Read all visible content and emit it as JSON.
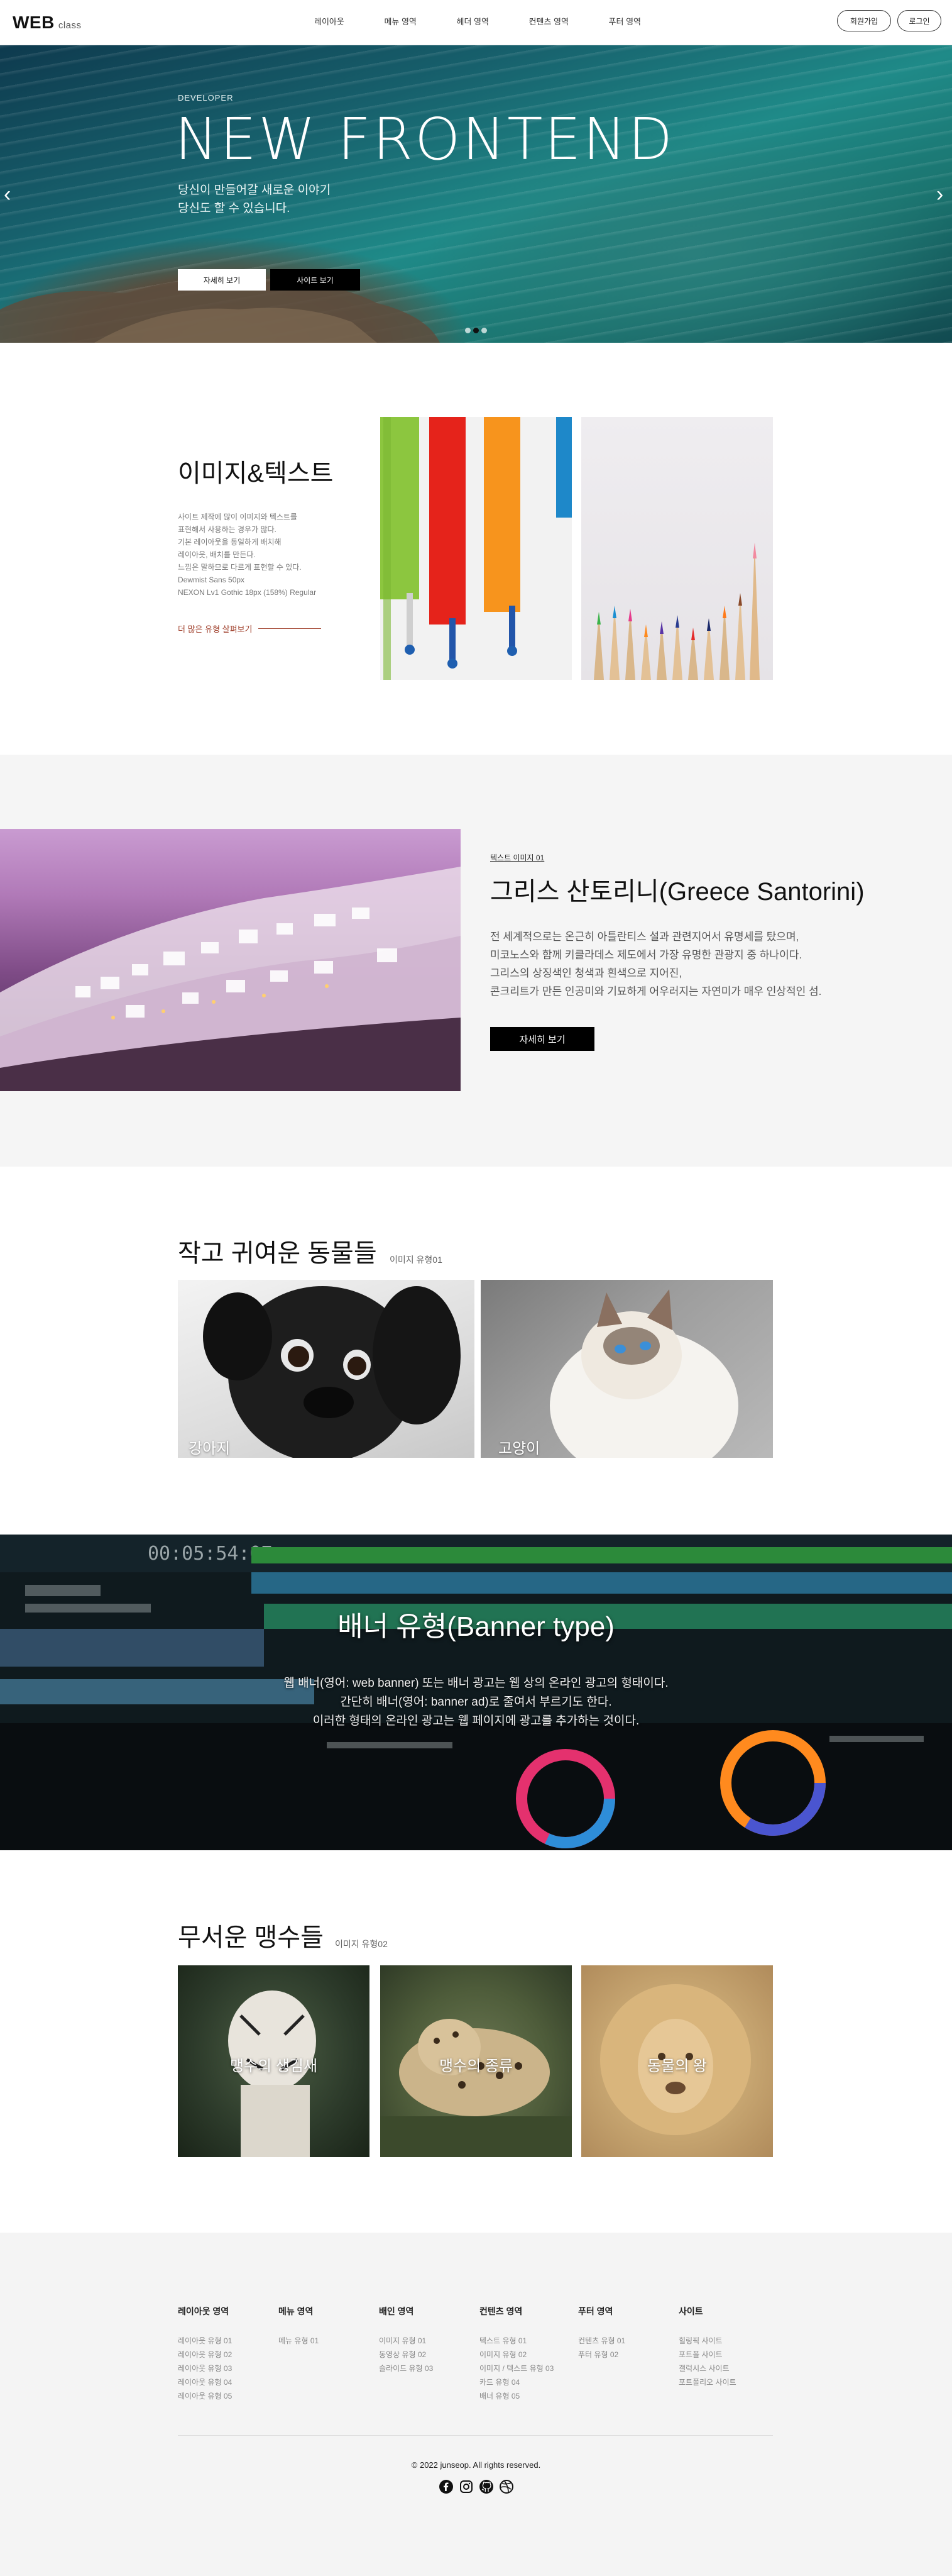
{
  "header": {
    "logo": "WEB",
    "logo_sub": "class",
    "nav": [
      "레이아웃",
      "메뉴 영역",
      "헤더 영역",
      "컨텐츠 영역",
      "푸터 영역"
    ],
    "join_label": "회원가입",
    "login_label": "로그인"
  },
  "hero": {
    "eyebrow": "DEVELOPER",
    "title": "NEW FRONTEND",
    "desc_line1": "당신이 만들어갈 새로운 이야기",
    "desc_line2": "당신도 할 수 있습니다.",
    "btn_more": "자세히 보기",
    "btn_site": "사이트 보기",
    "prev": "‹",
    "next": "›"
  },
  "image_text": {
    "title": "이미지&텍스트",
    "desc": [
      "사이트 제작에 많이 이미지와 텍스트를",
      "표현해서 사용하는 경우가 많다.",
      "기본 레이아웃을 동일하게 배치해",
      "레이아웃, 배치를 만든다.",
      "느낌은 말하므로 다르게 표현할 수 있다.",
      "Dewmist Sans 50px",
      "NEXON Lv1 Gothic 18px (158%) Regular"
    ],
    "more_label": "더 많은 유형 살펴보기"
  },
  "santorini": {
    "eyebrow": "텍스트 이미지 01",
    "title": "그리스 산토리니(Greece Santorini)",
    "desc": [
      "전 세계적으로는 온근히 아틀란티스 설과 관련지어서 유명세를 탔으며,",
      "미코노스와 함께 키클라데스 제도에서 가장 유명한 관광지 중 하나이다.",
      "그리스의 상징색인 청색과 흰색으로 지어진,",
      "콘크리트가 만든 인공미와 기묘하게 어우러지는 자연미가 매우 인상적인 섬."
    ],
    "btn_label": "자세히 보기"
  },
  "animals": {
    "title": "작고 귀여운 동물들",
    "sub": "이미지 유형01",
    "dog_caption": "강아지",
    "cat_caption": "고양이"
  },
  "banner": {
    "title": "배너 유형(Banner type)",
    "desc": [
      "웹 배너(영어: web banner) 또는 배너 광고는 웹 상의 온라인 광고의 형태이다.",
      "간단히 배너(영어: banner ad)로 줄여서 부르기도 한다.",
      "이러한 형태의 온라인 광고는 웹 페이지에 광고를 추가하는 것이다."
    ]
  },
  "big_cats": {
    "title": "무서운 맹수들",
    "sub": "이미지 유형02",
    "cards": [
      "맹수의 생김새",
      "맹수의 종류",
      "동물의 왕"
    ]
  },
  "footer": {
    "columns": [
      {
        "title": "레이아웃 영역",
        "items": [
          "레이아웃 유형 01",
          "레이아웃 유형 02",
          "레이아웃 유형 03",
          "레이아웃 유형 04",
          "레이아웃 유형 05"
        ]
      },
      {
        "title": "메뉴 영역",
        "items": [
          "메뉴 유형 01"
        ]
      },
      {
        "title": "배인 영역",
        "items": [
          "이미지 유형 01",
          "동영상 유형 02",
          "슬라이드 유형 03"
        ]
      },
      {
        "title": "컨텐츠 영역",
        "items": [
          "텍스트 유형 01",
          "이미지 유형 02",
          "이미지 / 텍스트 유형 03",
          "카드 유형 04",
          "배너 유형 05"
        ]
      },
      {
        "title": "푸터 영역",
        "items": [
          "컨텐츠 유형 01",
          "푸터 유형 02"
        ]
      },
      {
        "title": "사이트",
        "items": [
          "힐링픽 사이트",
          "포트폴 사이트",
          "갤럭시스 사이트",
          "포트폴리오 사이트"
        ]
      }
    ],
    "copyright": "© 2022 junseop. All rights reserved.",
    "socials": [
      "facebook-icon",
      "instagram-icon",
      "github-icon",
      "dribbble-icon"
    ]
  }
}
